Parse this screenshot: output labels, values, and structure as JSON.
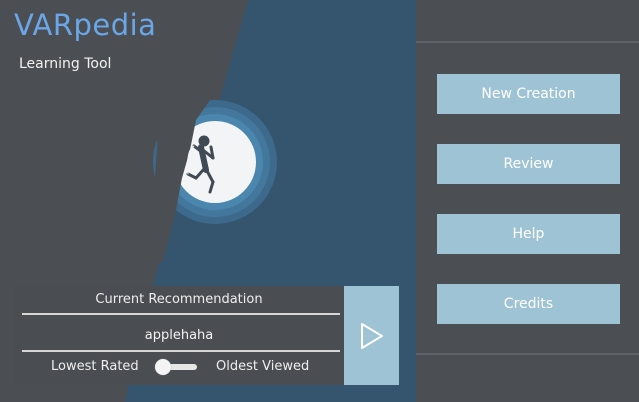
{
  "app": {
    "title": "VARpedia",
    "subtitle": "Learning Tool"
  },
  "recommendation": {
    "header": "Current Recommendation",
    "value": "applehaha",
    "toggle_left_label": "Lowest Rated",
    "toggle_right_label": "Oldest Viewed",
    "toggle_on": false
  },
  "menu": {
    "items": [
      {
        "label": "New Creation"
      },
      {
        "label": "Review"
      },
      {
        "label": "Help"
      },
      {
        "label": "Credits"
      }
    ]
  },
  "icons": {
    "play": "play-icon",
    "illustration": "climber-moon-illustration"
  },
  "colors": {
    "title_accent": "#6aa6e8",
    "button_bg": "#9ec3d5",
    "panel_bg": "#4a4e53",
    "mountain_blue": "#35546d"
  }
}
